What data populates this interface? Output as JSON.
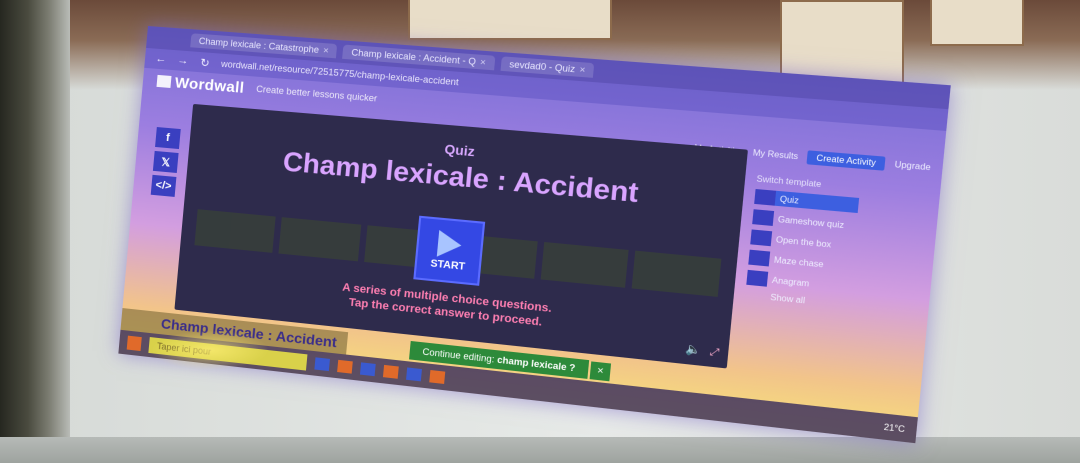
{
  "browser": {
    "tabs": [
      {
        "label": "Champ lexicale : Catastrophe"
      },
      {
        "label": "Champ lexicale : Accident - Q"
      },
      {
        "label": "sevdad0 - Quiz"
      }
    ],
    "url": "wordwall.net/resource/72515775/champ-lexicale-accident"
  },
  "wordwall": {
    "logo": "Wordwall",
    "tagline": "Create better lessons quicker",
    "nav": {
      "my_activities": "My Activities",
      "my_results": "My Results",
      "create": "Create Activity",
      "upgrade": "Upgrade"
    },
    "social": [
      "f",
      "𝕏",
      "</>"
    ]
  },
  "activity": {
    "type": "Quiz",
    "title": "Champ lexicale : Accident",
    "start_label": "START",
    "description_line1": "A series of multiple choice questions.",
    "description_line2": "Tap the correct answer to proceed."
  },
  "switch_template": {
    "header": "Switch template",
    "items": [
      {
        "label": "Quiz"
      },
      {
        "label": "Gameshow quiz"
      },
      {
        "label": "Open the box"
      },
      {
        "label": "Maze chase"
      },
      {
        "label": "Anagram"
      }
    ],
    "show_all": "Show all"
  },
  "continue_bar": {
    "title": "Champ lexicale : Accident",
    "edit_prefix": "Continue editing:",
    "edit_name": "champ lexicale ?",
    "close": "×"
  },
  "taskbar": {
    "search_placeholder": "Taper ici pour",
    "weather": "21°C"
  }
}
